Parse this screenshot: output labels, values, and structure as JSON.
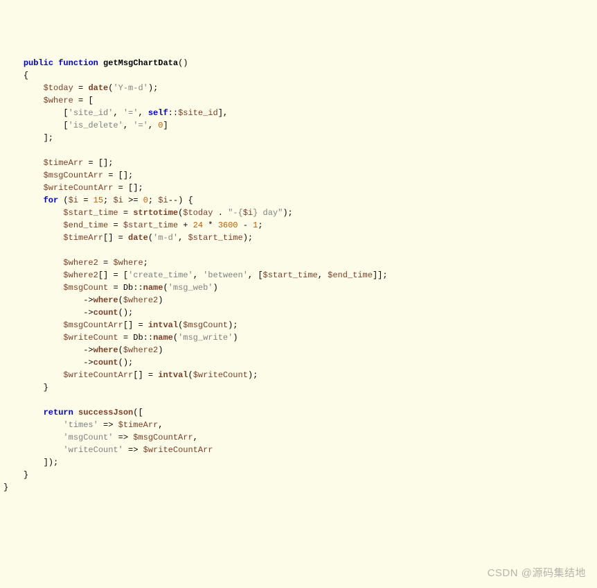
{
  "code": {
    "l1": {
      "kw1": "public",
      "kw2": "function",
      "name": "getMsgChartData"
    },
    "l2": "{",
    "l3": {
      "var": "$today",
      "op": "=",
      "fn": "date",
      "str": "'Y-m-d'"
    },
    "l4": {
      "var": "$where",
      "op": "=",
      "br": "["
    },
    "l5": {
      "str1": "'site_id'",
      "str2": "'='",
      "kw": "self",
      "op": "::",
      "var": "$site_id"
    },
    "l6": {
      "str1": "'is_delete'",
      "str2": "'='",
      "num": "0"
    },
    "l7": "];",
    "l8": {
      "var": "$timeArr",
      "op": "=",
      "val": "[]"
    },
    "l9": {
      "var": "$msgCountArr",
      "op": "=",
      "val": "[]"
    },
    "l10": {
      "var": "$writeCountArr",
      "op": "=",
      "val": "[]"
    },
    "l11": {
      "kw": "for",
      "var": "$i",
      "n1": "15",
      "n2": "0"
    },
    "l12": {
      "var1": "$start_time",
      "fn": "strtotime",
      "var2": "$today",
      "str1": "\"-{",
      "var3": "$i",
      "str2": "} day\""
    },
    "l13": {
      "var1": "$end_time",
      "var2": "$start_time",
      "n1": "24",
      "n2": "3600",
      "n3": "1"
    },
    "l14": {
      "var1": "$timeArr",
      "fn": "date",
      "str": "'m-d'",
      "var2": "$start_time"
    },
    "l15": {
      "var1": "$where2",
      "var2": "$where"
    },
    "l16": {
      "var1": "$where2",
      "str1": "'create_time'",
      "str2": "'between'",
      "var2": "$start_time",
      "var3": "$end_time"
    },
    "l17": {
      "var": "$msgCount",
      "cls": "Db",
      "fn": "name",
      "str": "'msg_web'"
    },
    "l18": {
      "fn": "where",
      "var": "$where2"
    },
    "l19": {
      "fn": "count"
    },
    "l20": {
      "var1": "$msgCountArr",
      "fn": "intval",
      "var2": "$msgCount"
    },
    "l21": {
      "var": "$writeCount",
      "cls": "Db",
      "fn": "name",
      "str": "'msg_write'"
    },
    "l22": {
      "fn": "where",
      "var": "$where2"
    },
    "l23": {
      "fn": "count"
    },
    "l24": {
      "var1": "$writeCountArr",
      "fn": "intval",
      "var2": "$writeCount"
    },
    "l25": "}",
    "l26": {
      "kw": "return",
      "fn": "successJson"
    },
    "l27": {
      "str": "'times'",
      "var": "$timeArr"
    },
    "l28": {
      "str": "'msgCount'",
      "var": "$msgCountArr"
    },
    "l29": {
      "str": "'writeCount'",
      "var": "$writeCountArr"
    },
    "l30": "]);",
    "l31": "}",
    "l32": "}"
  },
  "watermark": "CSDN @源码集结地"
}
